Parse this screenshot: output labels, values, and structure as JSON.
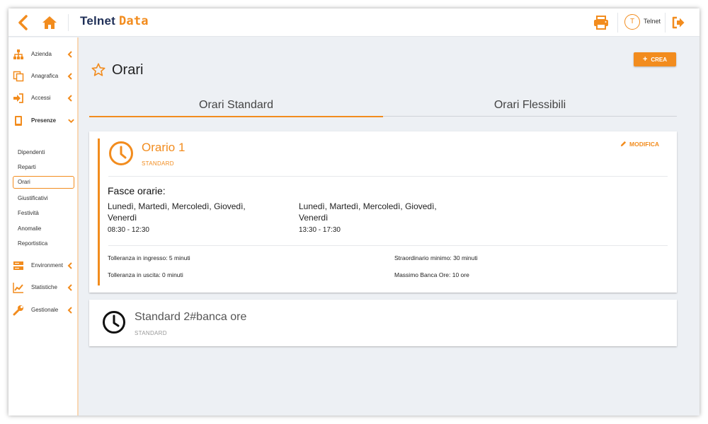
{
  "colors": {
    "accent": "#f28c1e",
    "navy": "#1f2f57",
    "background": "#edf0f4"
  },
  "header": {
    "logo_part1": "Telnet",
    "logo_part2": "Data",
    "user_initial": "T",
    "user_name": "Telnet"
  },
  "sidebar": {
    "items": [
      {
        "label": "Azienda",
        "icon": "sitemap-icon"
      },
      {
        "label": "Anagrafica",
        "icon": "copy-icon"
      },
      {
        "label": "Accessi",
        "icon": "sign-in-icon"
      },
      {
        "label": "Presenze",
        "icon": "tablet-icon"
      },
      {
        "label": "Environment",
        "icon": "server-icon"
      },
      {
        "label": "Statistiche",
        "icon": "line-chart-icon"
      },
      {
        "label": "Gestionale",
        "icon": "wrench-icon"
      }
    ],
    "subitems": [
      "Dipendenti",
      "Reparti",
      "Orari",
      "Giustificativi",
      "Festività",
      "Anomalie",
      "Reportistica"
    ]
  },
  "main": {
    "title": "Orari",
    "crea_label": "CREA",
    "tabs": [
      "Orari Standard",
      "Orari Flessibili"
    ],
    "cards": [
      {
        "title": "Orario 1",
        "subtitle": "STANDARD",
        "edit_label": "MODIFICA",
        "section_title": "Fasce orarie:",
        "slots": [
          {
            "days": "Lunedì, Martedì, Mercoledì, Giovedì, Venerdì",
            "hours": "08:30 - 12:30"
          },
          {
            "days": "Lunedì, Martedì, Mercoledì, Giovedì, Venerdì",
            "hours": "13:30 - 17:30"
          }
        ],
        "details": {
          "tolleranza_ingresso": "Tolleranza in ingresso: 5 minuti",
          "tolleranza_uscita": "Tolleranza in uscita: 0 minuti",
          "straordinario_minimo": "Straordinario minimo: 30 minuti",
          "massimo_banca_ore": "Massimo Banca Ore: 10 ore"
        }
      },
      {
        "title": "Standard 2#banca ore",
        "subtitle": "STANDARD"
      }
    ]
  }
}
